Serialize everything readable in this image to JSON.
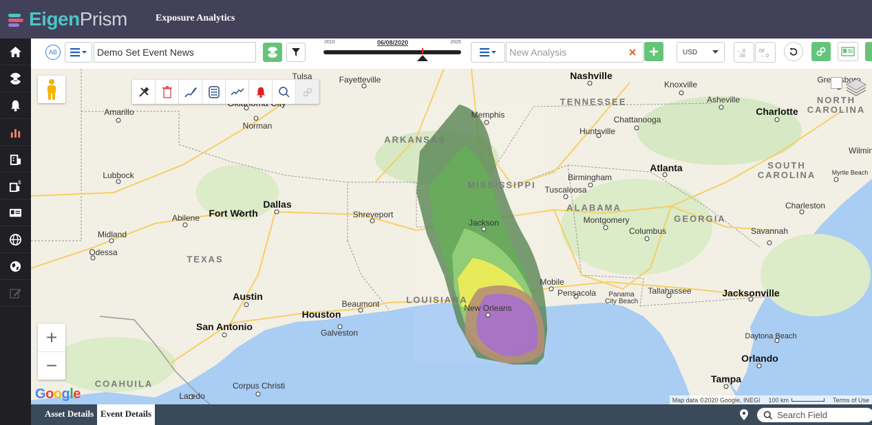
{
  "header": {
    "logo_part1": "Eigen",
    "logo_part2": "Prism",
    "app_title": "Exposure Analytics"
  },
  "sidebar": {
    "items": [
      {
        "icon": "home-icon"
      },
      {
        "icon": "hazard-icon"
      },
      {
        "icon": "bell-icon"
      },
      {
        "icon": "bar-chart-icon"
      },
      {
        "icon": "building-icon"
      },
      {
        "icon": "building-dollar-icon"
      },
      {
        "icon": "id-card-icon"
      },
      {
        "icon": "globe-icon"
      },
      {
        "icon": "globe-pin-icon"
      },
      {
        "icon": "edit-icon"
      }
    ]
  },
  "toolbar": {
    "avatar_initials": "AB",
    "event_set_value": "Demo Set Event News",
    "timeline": {
      "start_label": "2010",
      "end_label": "2025",
      "current_date": "06/08/2020",
      "position": 0.72
    },
    "analysis_placeholder": "New Analysis",
    "currency": "USD"
  },
  "map": {
    "states": [
      {
        "label": "ARKANSAS"
      },
      {
        "label": "MISSISSIPPI"
      },
      {
        "label": "TENNESSEE"
      },
      {
        "label": "NORTH\nCAROLINA"
      },
      {
        "label": "SOUTH\nCAROLINA"
      },
      {
        "label": "ALABAMA"
      },
      {
        "label": "GEORGIA"
      },
      {
        "label": "TEXAS"
      },
      {
        "label": "LOUISIANA"
      },
      {
        "label": "COAHUILA"
      }
    ],
    "cities": [
      {
        "name": "Tulsa"
      },
      {
        "name": "Fayetteville"
      },
      {
        "name": "Nashville"
      },
      {
        "name": "Knoxville"
      },
      {
        "name": "Greensboro"
      },
      {
        "name": "Asheville"
      },
      {
        "name": "Charlotte"
      },
      {
        "name": "Amarillo"
      },
      {
        "name": "Oklahoma City"
      },
      {
        "name": "Norman"
      },
      {
        "name": "Memphis"
      },
      {
        "name": "Chattanooga"
      },
      {
        "name": "Huntsville"
      },
      {
        "name": "Wilmin"
      },
      {
        "name": "Atlanta"
      },
      {
        "name": "Birmingham"
      },
      {
        "name": "Tuscaloosa"
      },
      {
        "name": "Myrtle Beach"
      },
      {
        "name": "Lubbock"
      },
      {
        "name": "Dallas"
      },
      {
        "name": "Fort Worth"
      },
      {
        "name": "Shreveport"
      },
      {
        "name": "Abilene"
      },
      {
        "name": "Jackson"
      },
      {
        "name": "Montgomery"
      },
      {
        "name": "Columbus"
      },
      {
        "name": "Charleston"
      },
      {
        "name": "Midland"
      },
      {
        "name": "Odessa"
      },
      {
        "name": "Savannah"
      },
      {
        "name": "Mobile"
      },
      {
        "name": "Pensacola"
      },
      {
        "name": "Tallahassee"
      },
      {
        "name": "Panama\nCity Beach"
      },
      {
        "name": "Austin"
      },
      {
        "name": "Beaumont"
      },
      {
        "name": "Houston"
      },
      {
        "name": "New Orleans"
      },
      {
        "name": "Jacksonville"
      },
      {
        "name": "San Antonio"
      },
      {
        "name": "Galveston"
      },
      {
        "name": "Daytona Beach"
      },
      {
        "name": "Orlando"
      },
      {
        "name": "Tampa"
      },
      {
        "name": "Corpus Christi"
      },
      {
        "name": "Laredo"
      }
    ],
    "google_logo": "Google",
    "attribution": {
      "map_data": "Map data ©2020 Google, INEGI",
      "scale": "100 km",
      "terms": "Terms of Use"
    }
  },
  "bottom": {
    "tabs": [
      {
        "label": "Asset Details"
      },
      {
        "label": "Event Details"
      }
    ],
    "search_placeholder": "Search Field"
  }
}
